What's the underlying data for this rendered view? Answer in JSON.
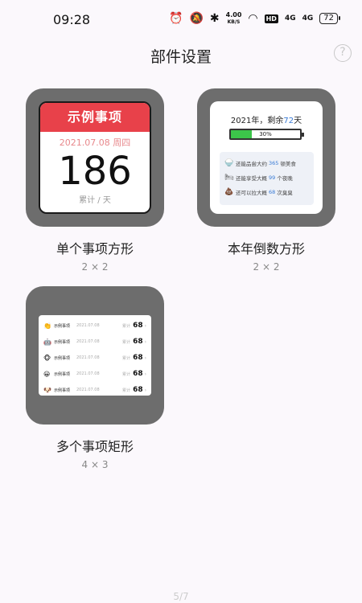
{
  "status_bar": {
    "time": "09:28",
    "net_speed_value": "4.00",
    "net_speed_unit": "KB/S",
    "hd_badge": "HD",
    "sig1": "4G",
    "sig2": "4G",
    "battery": "72"
  },
  "header": {
    "title": "部件设置",
    "help": "?"
  },
  "widgets": [
    {
      "name": "单个事项方形",
      "size": "2 × 2",
      "preview": {
        "header": "示例事项",
        "date": "2021.07.08 周四",
        "number": "186",
        "unit": "累计 / 天"
      }
    },
    {
      "name": "本年倒数方形",
      "size": "2 × 2",
      "preview": {
        "title_prefix": "2021年，剩余",
        "title_num": "72",
        "title_suffix": "天",
        "progress_label": "30%",
        "progress": 0.3,
        "rows": [
          {
            "icon": "🍚",
            "pre": "还能品尝大约",
            "num": "365",
            "post": "顿美食"
          },
          {
            "icon": "🛏",
            "pre": "还能享受大概",
            "num": "99",
            "post": "个夜晚"
          },
          {
            "icon": "💩",
            "pre": "还可以拉大概",
            "num": "68",
            "post": "次臭臭"
          }
        ]
      }
    },
    {
      "name": "多个事项矩形",
      "size": "4 × 3",
      "preview": {
        "rows": [
          {
            "icon": "👏",
            "name": "示例事项",
            "date": "2021.07.08",
            "label": "累计",
            "value": "68"
          },
          {
            "icon": "🤖",
            "name": "示例事项",
            "date": "2021.07.08",
            "label": "累计",
            "value": "68"
          },
          {
            "icon": "🐵",
            "name": "示例事项",
            "date": "2021.07.08",
            "label": "累计",
            "value": "68"
          },
          {
            "icon": "😀",
            "name": "示例事项",
            "date": "2021.07.08",
            "label": "累计",
            "value": "68"
          },
          {
            "icon": "🐶",
            "name": "示例事项",
            "date": "2021.07.08",
            "label": "累计",
            "value": "68"
          }
        ],
        "chevron": "›"
      }
    }
  ],
  "pager": "5/7",
  "colors": {
    "accent_red": "#e8414a",
    "accent_blue": "#3a7bd5",
    "progress_green": "#3cc54a",
    "frame_gray": "#6d6d6d"
  }
}
